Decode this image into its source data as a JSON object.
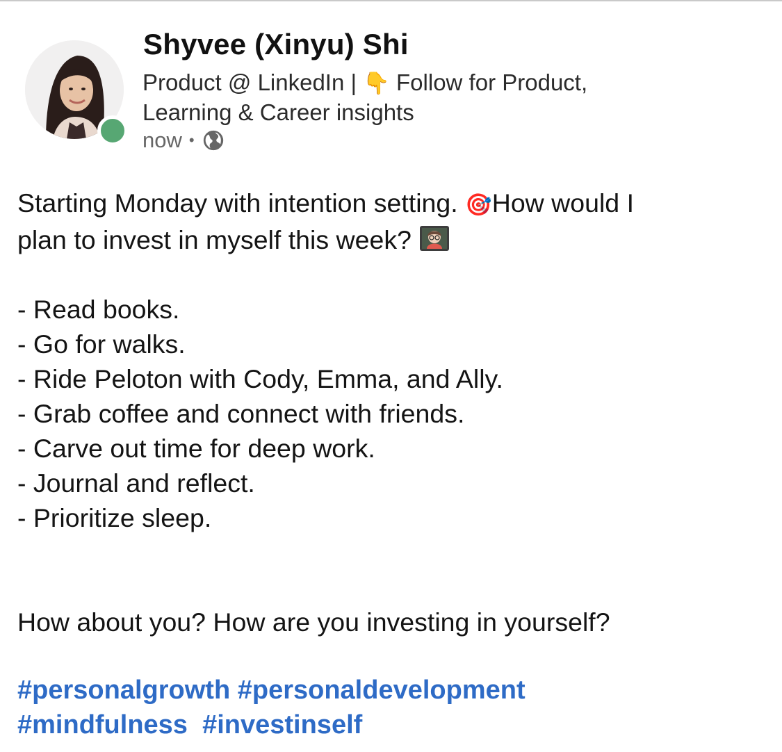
{
  "post": {
    "author": {
      "name": "Shyvee (Xinyu) Shi",
      "headline_part1": "Product @ LinkedIn | ",
      "headline_emoji": "👇",
      "headline_part2": " Follow for Product,",
      "headline_line2": "Learning & Career insights",
      "timestamp": "now",
      "separator": "•",
      "visibility_icon": "globe-icon",
      "presence_color": "#57a773"
    },
    "body": {
      "intro_line1": "Starting Monday with intention setting. ",
      "intro_emoji": "🎯",
      "intro_line1b": "How would I",
      "intro_line2": "plan to invest in myself this week? ",
      "intro_emoji2": "teacher-emoji",
      "items": [
        "- Read books.",
        "- Go for walks.",
        "- Ride Peloton with Cody, Emma, and Ally.",
        "- Grab coffee and connect with friends.",
        "- Carve out time for deep work.",
        "- Journal and reflect.",
        "- Prioritize sleep."
      ],
      "closing": "How about you? How are you investing in yourself?"
    },
    "hashtags": {
      "line1": [
        "#personalgrowth",
        "#personaldevelopment"
      ],
      "line2": [
        "#mindfulness",
        "#investinself"
      ],
      "color": "#2e6bc6"
    }
  }
}
